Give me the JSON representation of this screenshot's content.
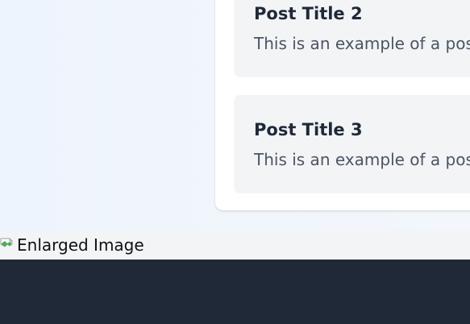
{
  "posts": [
    {
      "title": "Post Title 2",
      "excerpt": "This is an example of a post excerpt."
    },
    {
      "title": "Post Title 3",
      "excerpt": "This is an example of a post excerpt."
    }
  ],
  "lightbox": {
    "image_alt": "Enlarged Image"
  },
  "icons": {
    "broken_image": "broken-image-icon"
  },
  "colors": {
    "background": "#eef4fd",
    "panel": "#ffffff",
    "card": "#f3f4f6",
    "title": "#1f2937",
    "excerpt": "#4b5563",
    "footer": "#1f2937"
  }
}
